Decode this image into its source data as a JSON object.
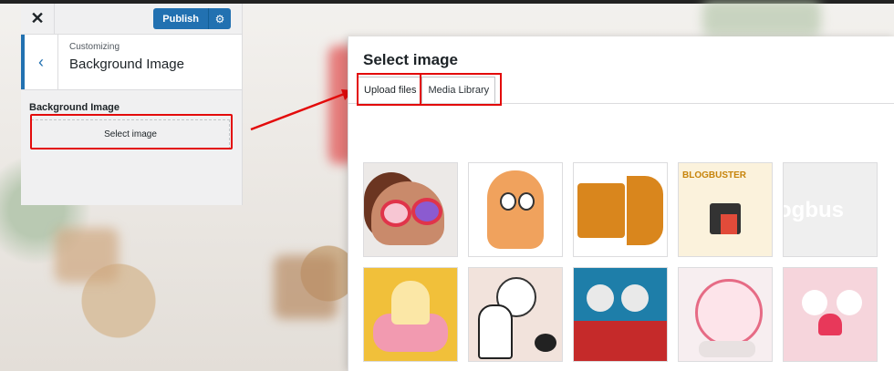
{
  "panel": {
    "close_icon": "close-icon",
    "publish_label": "Publish",
    "settings_icon": "gear-icon",
    "back_icon": "chevron-left-icon",
    "breadcrumb": "Customizing",
    "section_title": "Background Image",
    "field_label": "Background Image",
    "select_button_label": "Select image"
  },
  "modal": {
    "title": "Select image",
    "tabs": [
      {
        "label": "Upload files",
        "active": true
      },
      {
        "label": "Media Library",
        "active": false
      }
    ],
    "thumbnails": [
      {
        "name": "girl-with-glasses"
      },
      {
        "name": "orange-ghost"
      },
      {
        "name": "camera-b-logo"
      },
      {
        "name": "blogbuster-night",
        "text": "BLOGBUSTER"
      },
      {
        "name": "blogbuster-text",
        "text": "ogbus"
      },
      {
        "name": "popcorn-sofa"
      },
      {
        "name": "halloween-ghost"
      },
      {
        "name": "cinema-skeletons"
      },
      {
        "name": "heart-snowglobe"
      },
      {
        "name": "heart-couple"
      }
    ]
  },
  "colors": {
    "accent": "#2271b1",
    "highlight": "#e30b0b"
  }
}
